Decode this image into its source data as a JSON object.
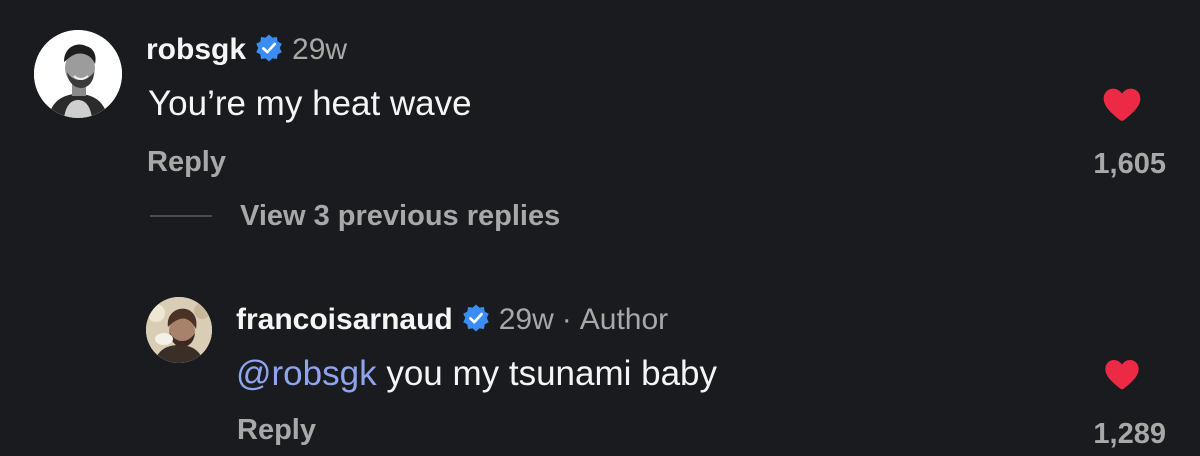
{
  "colors": {
    "background": "#191b1f",
    "text_primary": "#f5f5f5",
    "text_secondary": "#a8a8a8",
    "mention": "#8fa4ee",
    "verified_badge": "#3a8df5",
    "heart": "#ed2a45"
  },
  "comments": [
    {
      "username": "robsgk",
      "verified": true,
      "age": "29w",
      "text": "You’re my heat wave",
      "reply_label": "Reply",
      "like_count": "1,605",
      "liked": true,
      "avatar_icon": "profile-photo"
    }
  ],
  "thread": {
    "view_replies_label": "View 3 previous replies"
  },
  "replies": [
    {
      "username": "francoisarnaud",
      "verified": true,
      "age": "29w",
      "separator": "·",
      "badge": "Author",
      "mention": "@robsgk",
      "text": " you my tsunami baby",
      "reply_label": "Reply",
      "like_count": "1,289",
      "liked": true,
      "avatar_icon": "profile-photo"
    }
  ]
}
